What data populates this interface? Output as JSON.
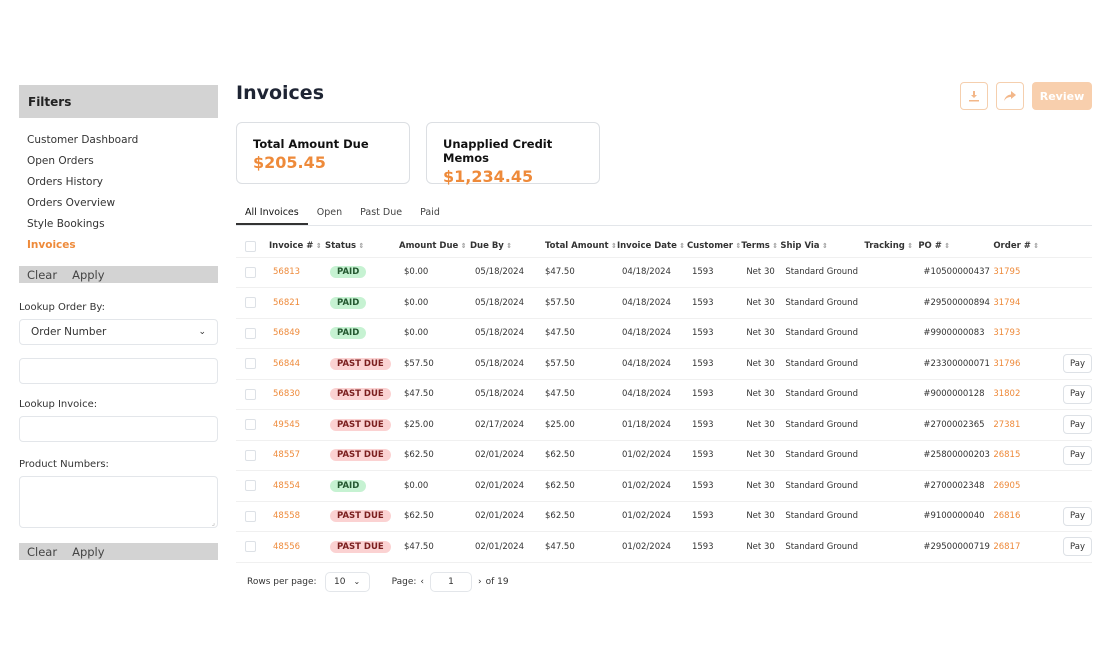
{
  "sidebar": {
    "title": "Filters",
    "nav": [
      "Customer Dashboard",
      "Open Orders",
      "Orders History",
      "Orders Overview",
      "Style Bookings",
      "Invoices"
    ],
    "active_nav": "Invoices",
    "clear_label": "Clear",
    "apply_label": "Apply",
    "lookup_order_label": "Lookup Order By:",
    "lookup_order_value": "Order Number",
    "order_input_value": "",
    "lookup_invoice_label": "Lookup Invoice:",
    "lookup_invoice_value": "",
    "product_numbers_label": "Product Numbers:",
    "product_numbers_value": ""
  },
  "header": {
    "title": "Invoices",
    "download_icon": "download-icon",
    "share_icon": "share-icon",
    "review_label": "Review"
  },
  "cards": [
    {
      "title": "Total Amount Due",
      "value": "$205.45"
    },
    {
      "title": "Unapplied Credit Memos",
      "value": "$1,234.45"
    }
  ],
  "tabs": [
    "All Invoices",
    "Open",
    "Past Due",
    "Paid"
  ],
  "active_tab": "All Invoices",
  "table": {
    "columns": [
      "Invoice #",
      "Status",
      "Amount Due",
      "Due By",
      "Total Amount",
      "Invoice Date",
      "Customer",
      "Terms",
      "Ship Via",
      "Tracking",
      "PO #",
      "Order #"
    ],
    "rows": [
      {
        "invoice": "56813",
        "status": "PAID",
        "amount_due": "$0.00",
        "due_by": "05/18/2024",
        "total": "$47.50",
        "date": "04/18/2024",
        "customer": "1593",
        "terms": "Net 30",
        "ship": "Standard Ground",
        "tracking": "",
        "po": "#10500000437",
        "order": "31795",
        "pay": false
      },
      {
        "invoice": "56821",
        "status": "PAID",
        "amount_due": "$0.00",
        "due_by": "05/18/2024",
        "total": "$57.50",
        "date": "04/18/2024",
        "customer": "1593",
        "terms": "Net 30",
        "ship": "Standard Ground",
        "tracking": "",
        "po": "#29500000894",
        "order": "31794",
        "pay": false
      },
      {
        "invoice": "56849",
        "status": "PAID",
        "amount_due": "$0.00",
        "due_by": "05/18/2024",
        "total": "$47.50",
        "date": "04/18/2024",
        "customer": "1593",
        "terms": "Net 30",
        "ship": "Standard Ground",
        "tracking": "",
        "po": "#9900000083",
        "order": "31793",
        "pay": false
      },
      {
        "invoice": "56844",
        "status": "PAST DUE",
        "amount_due": "$57.50",
        "due_by": "05/18/2024",
        "total": "$57.50",
        "date": "04/18/2024",
        "customer": "1593",
        "terms": "Net 30",
        "ship": "Standard Ground",
        "tracking": "",
        "po": "#23300000071",
        "order": "31796",
        "pay": true
      },
      {
        "invoice": "56830",
        "status": "PAST DUE",
        "amount_due": "$47.50",
        "due_by": "05/18/2024",
        "total": "$47.50",
        "date": "04/18/2024",
        "customer": "1593",
        "terms": "Net 30",
        "ship": "Standard Ground",
        "tracking": "",
        "po": "#9000000128",
        "order": "31802",
        "pay": true
      },
      {
        "invoice": "49545",
        "status": "PAST DUE",
        "amount_due": "$25.00",
        "due_by": "02/17/2024",
        "total": "$25.00",
        "date": "01/18/2024",
        "customer": "1593",
        "terms": "Net 30",
        "ship": "Standard Ground",
        "tracking": "",
        "po": "#2700002365",
        "order": "27381",
        "pay": true
      },
      {
        "invoice": "48557",
        "status": "PAST DUE",
        "amount_due": "$62.50",
        "due_by": "02/01/2024",
        "total": "$62.50",
        "date": "01/02/2024",
        "customer": "1593",
        "terms": "Net 30",
        "ship": "Standard Ground",
        "tracking": "",
        "po": "#25800000203",
        "order": "26815",
        "pay": true
      },
      {
        "invoice": "48554",
        "status": "PAID",
        "amount_due": "$0.00",
        "due_by": "02/01/2024",
        "total": "$62.50",
        "date": "01/02/2024",
        "customer": "1593",
        "terms": "Net 30",
        "ship": "Standard Ground",
        "tracking": "",
        "po": "#2700002348",
        "order": "26905",
        "pay": false
      },
      {
        "invoice": "48558",
        "status": "PAST DUE",
        "amount_due": "$62.50",
        "due_by": "02/01/2024",
        "total": "$62.50",
        "date": "01/02/2024",
        "customer": "1593",
        "terms": "Net 30",
        "ship": "Standard Ground",
        "tracking": "",
        "po": "#9100000040",
        "order": "26816",
        "pay": true
      },
      {
        "invoice": "48556",
        "status": "PAST DUE",
        "amount_due": "$47.50",
        "due_by": "02/01/2024",
        "total": "$47.50",
        "date": "01/02/2024",
        "customer": "1593",
        "terms": "Net 30",
        "ship": "Standard Ground",
        "tracking": "",
        "po": "#29500000719",
        "order": "26817",
        "pay": true
      }
    ],
    "pay_label": "Pay"
  },
  "pagination": {
    "rows_per_page_label": "Rows per page:",
    "rows_per_page": "10",
    "page_label": "Page:",
    "page": "1",
    "of_label": "of 19"
  },
  "colors": {
    "accent": "#ee8a3a",
    "paid_bg": "#c6f2d2",
    "past_due_bg": "#fbd2d2"
  }
}
